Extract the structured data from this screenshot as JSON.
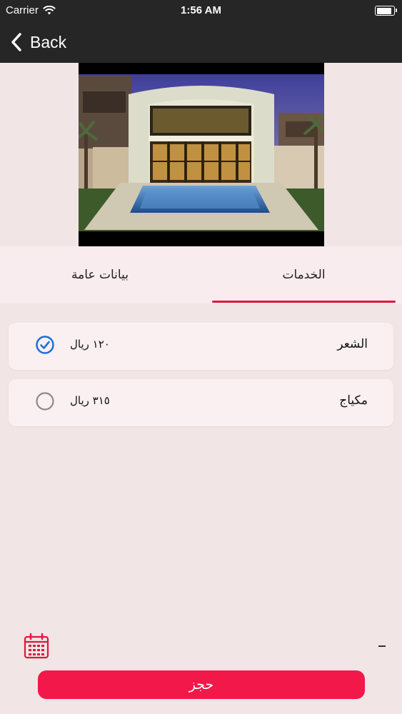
{
  "status_bar": {
    "carrier": "Carrier",
    "time": "1:56 AM"
  },
  "nav": {
    "back_label": "Back"
  },
  "tabs": {
    "general": "بيانات عامة",
    "services": "الخدمات",
    "active": "services"
  },
  "services": [
    {
      "name": "الشعر",
      "price": "١٢٠ ريال",
      "selected": true
    },
    {
      "name": "مكياج",
      "price": "٣١٥ ريال",
      "selected": false
    }
  ],
  "footer": {
    "book_label": "حجز"
  },
  "colors": {
    "accent": "#f2184a",
    "tab_indicator": "#e0163f",
    "check": "#1d6fd6"
  }
}
